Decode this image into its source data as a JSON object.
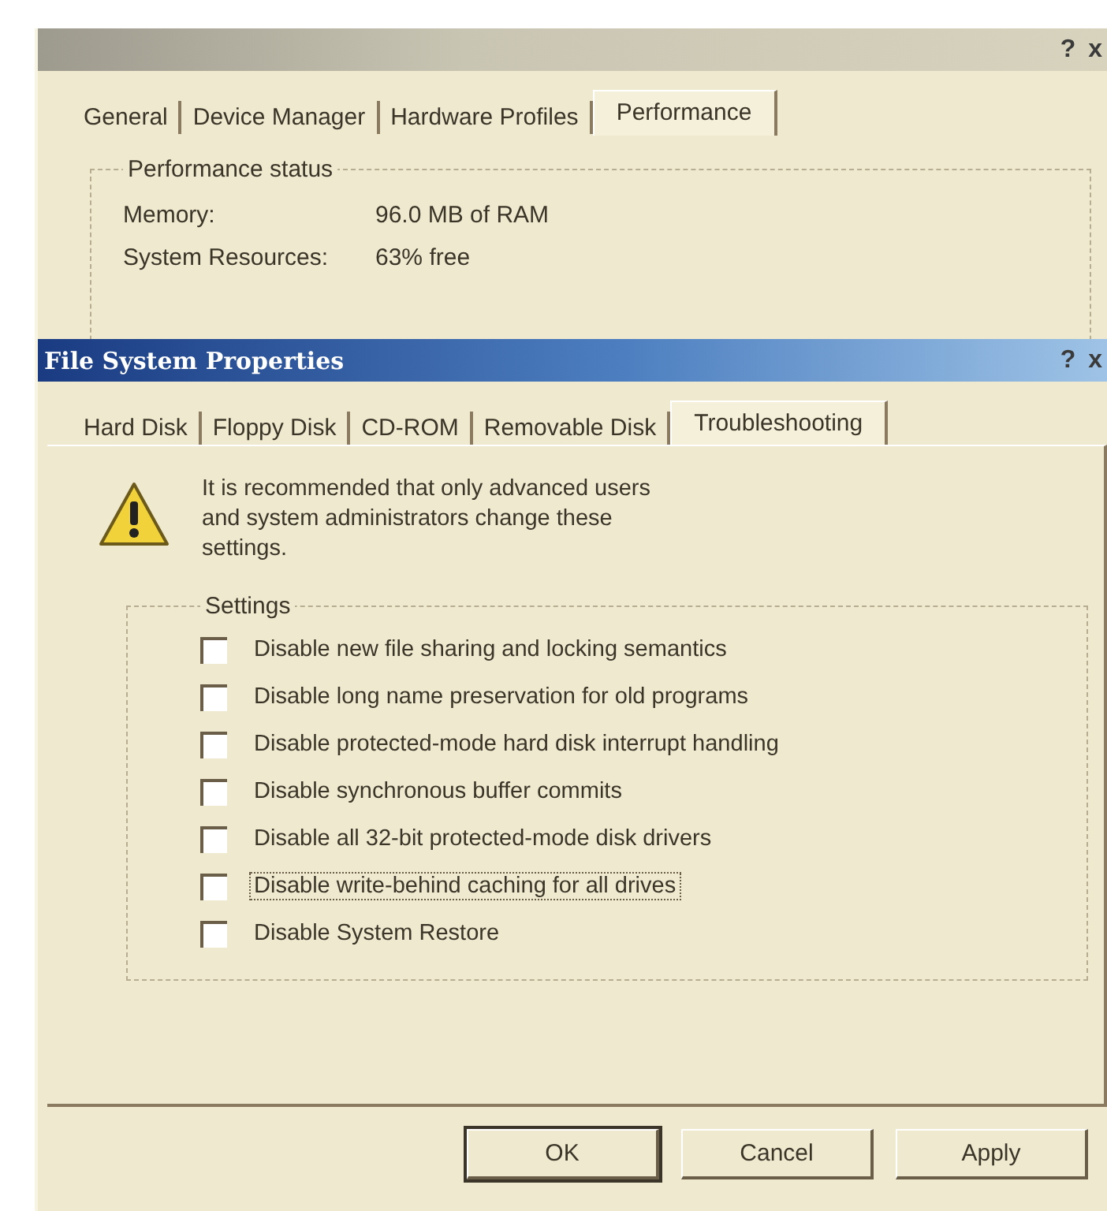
{
  "back_window": {
    "title_buttons": [
      "?",
      "x"
    ],
    "tabs": [
      {
        "label": "General",
        "selected": false
      },
      {
        "label": "Device Manager",
        "selected": false
      },
      {
        "label": "Hardware Profiles",
        "selected": false
      },
      {
        "label": "Performance",
        "selected": true
      }
    ],
    "performance_status": {
      "title": "Performance status",
      "rows": [
        {
          "label": "Memory:",
          "value": "96.0 MB of RAM"
        },
        {
          "label": "System Resources:",
          "value": "63% free"
        }
      ]
    }
  },
  "front_window": {
    "title": "File System Properties",
    "title_buttons": [
      "?",
      "x"
    ],
    "tabs": [
      {
        "label": "Hard Disk",
        "selected": false
      },
      {
        "label": "Floppy Disk",
        "selected": false
      },
      {
        "label": "CD-ROM",
        "selected": false
      },
      {
        "label": "Removable Disk",
        "selected": false
      },
      {
        "label": "Troubleshooting",
        "selected": true
      }
    ],
    "warning": "It is recommended that only advanced users and system administrators change these settings.",
    "settings": {
      "title": "Settings",
      "options": [
        {
          "label": "Disable new file sharing and locking semantics",
          "checked": false,
          "focused": false
        },
        {
          "label": "Disable long name preservation for old programs",
          "checked": false,
          "focused": false
        },
        {
          "label": "Disable protected-mode hard disk interrupt handling",
          "checked": false,
          "focused": false
        },
        {
          "label": "Disable synchronous buffer commits",
          "checked": false,
          "focused": false
        },
        {
          "label": "Disable all 32-bit protected-mode disk drivers",
          "checked": false,
          "focused": false
        },
        {
          "label": "Disable write-behind caching for all drives",
          "checked": false,
          "focused": true
        },
        {
          "label": "Disable System Restore",
          "checked": false,
          "focused": false
        }
      ]
    },
    "buttons": [
      {
        "label": "OK",
        "default": true
      },
      {
        "label": "Cancel",
        "default": false
      },
      {
        "label": "Apply",
        "default": false
      }
    ]
  }
}
